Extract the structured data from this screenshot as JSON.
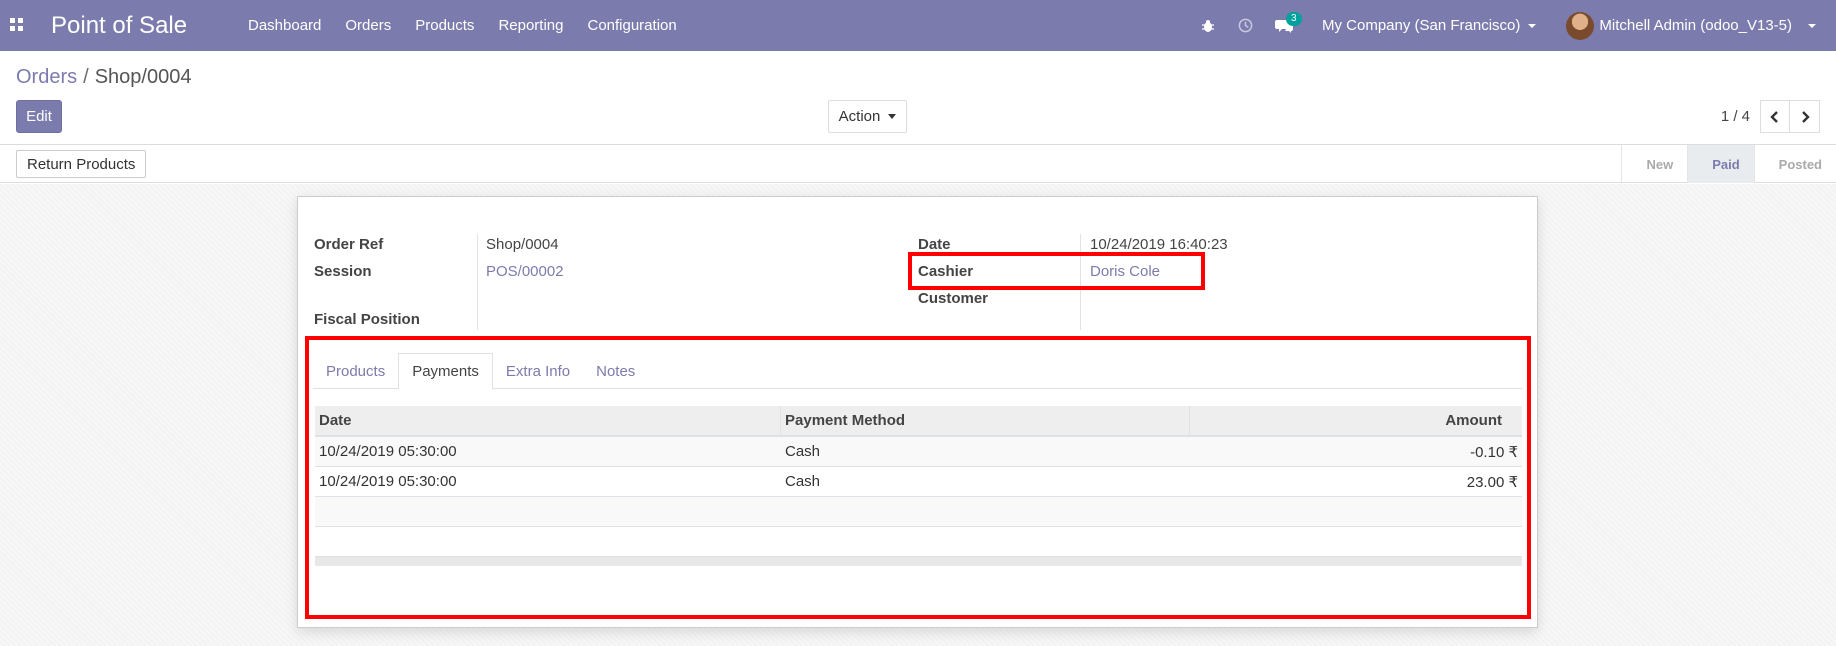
{
  "navbar": {
    "app_name": "Point of Sale",
    "menu": [
      "Dashboard",
      "Orders",
      "Products",
      "Reporting",
      "Configuration"
    ],
    "message_badge": "3",
    "company": "My Company (San Francisco)",
    "user": "Mitchell Admin (odoo_V13-5)",
    "icons": [
      "apps-icon",
      "bug-icon",
      "clock-icon",
      "chat-icon"
    ]
  },
  "breadcrumb": {
    "parent": "Orders",
    "current": "Shop/0004"
  },
  "controls": {
    "edit_label": "Edit",
    "action_label": "Action",
    "pager": "1 / 4"
  },
  "statusbar": {
    "return_label": "Return Products",
    "stages": [
      "New",
      "Paid",
      "Posted"
    ],
    "active_stage": "Paid"
  },
  "form": {
    "order_ref_label": "Order Ref",
    "order_ref": "Shop/0004",
    "session_label": "Session",
    "session": "POS/00002",
    "fiscal_label": "Fiscal Position",
    "date_label": "Date",
    "date": "10/24/2019 16:40:23",
    "cashier_label": "Cashier",
    "cashier": "Doris Cole",
    "customer_label": "Customer"
  },
  "notebook": {
    "tabs": [
      "Products",
      "Payments",
      "Extra Info",
      "Notes"
    ],
    "active_tab": "Payments",
    "columns": [
      "Date",
      "Payment Method",
      "Amount"
    ],
    "rows": [
      [
        "10/24/2019 05:30:00",
        "Cash",
        "-0.10 ₹"
      ],
      [
        "10/24/2019 05:30:00",
        "Cash",
        "23.00 ₹"
      ]
    ]
  },
  "colors": {
    "brand": "#7c7bad",
    "highlight": "#ff0000"
  }
}
